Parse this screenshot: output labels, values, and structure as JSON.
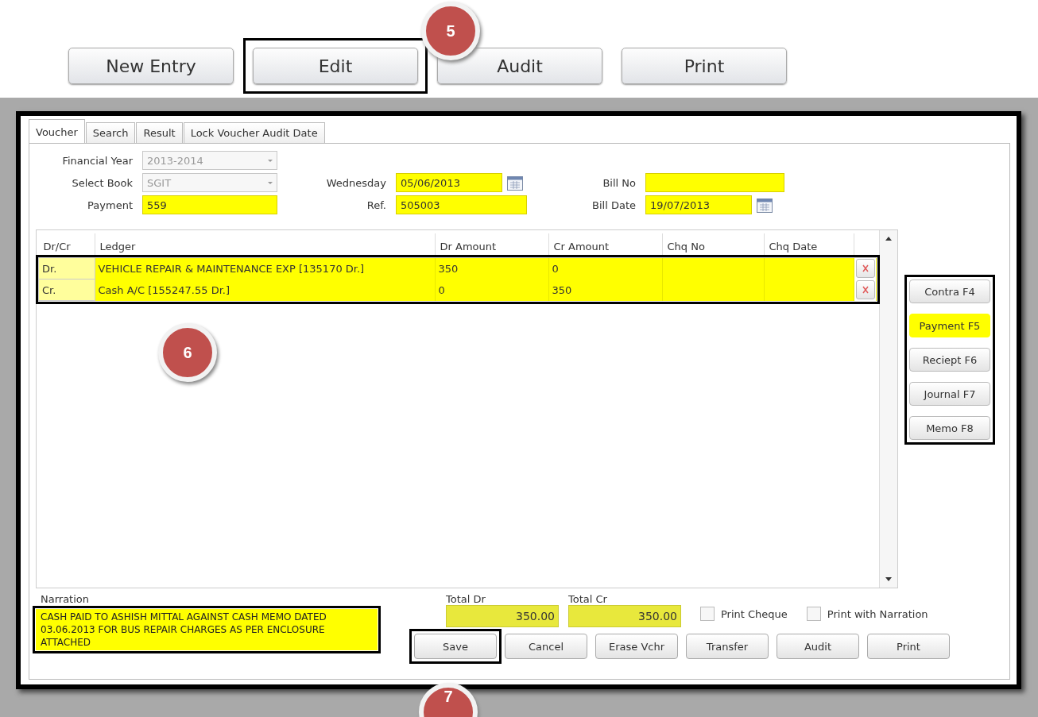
{
  "top_toolbar": {
    "buttons": [
      {
        "label": "New Entry"
      },
      {
        "label": "Edit"
      },
      {
        "label": "Audit"
      },
      {
        "label": "Print"
      }
    ]
  },
  "tabs": [
    {
      "label": "Voucher",
      "selected": true
    },
    {
      "label": "Search",
      "selected": false
    },
    {
      "label": "Result",
      "selected": false
    },
    {
      "label": "Lock Voucher Audit Date",
      "selected": false
    }
  ],
  "form_fields": [
    {
      "label": "Financial Year",
      "value": "2013-2014",
      "kind": "dropdown",
      "disabled": true
    },
    {
      "label": "Select Book",
      "value": "SGIT",
      "kind": "dropdown",
      "disabled": true
    },
    {
      "label": "Wednesday",
      "value": "05/06/2013",
      "kind": "date",
      "disabled": false
    },
    {
      "label": "Bill No",
      "kind": "text",
      "disabled": false
    },
    {
      "label": "Payment",
      "value": "559",
      "kind": "text",
      "disabled": false
    },
    {
      "label": "Ref.",
      "value": "505003",
      "kind": "text",
      "disabled": false
    },
    {
      "label": "Bill Date",
      "value": "19/07/2013",
      "kind": "date",
      "disabled": false
    }
  ],
  "entries_table": {
    "columns": [
      "Dr/Cr",
      "Ledger",
      "Dr Amount",
      "Cr Amount",
      "Chq No",
      "Chq Date"
    ],
    "rows": [
      {
        "dr_cr": "Dr.",
        "ledger": "VEHICLE REPAIR & MAINTENANCE EXP [135170 Dr.]",
        "dr_amount": "350",
        "cr_amount": "0"
      },
      {
        "dr_cr": "Cr.",
        "ledger": "Cash A/C [155247.55 Dr.]",
        "dr_amount": "0",
        "cr_amount": "350"
      }
    ]
  },
  "voucher_types": [
    {
      "label": "Contra F4",
      "selected": false
    },
    {
      "label": "Payment F5",
      "selected": true
    },
    {
      "label": "Reciept F6",
      "selected": false
    },
    {
      "label": "Journal F7",
      "selected": false
    },
    {
      "label": "Memo F8",
      "selected": false
    }
  ],
  "narration": {
    "label": "Narration",
    "value": "CASH PAID TO ASHISH MITTAL AGAINST CASH MEMO DATED 03.06.2013 FOR BUS REPAIR CHARGES AS PER ENCLOSURE ATTACHED"
  },
  "totals": [
    {
      "label": "Total Dr",
      "value": "350.00"
    },
    {
      "label": "Total Cr",
      "value": "350.00"
    }
  ],
  "options": [
    {
      "label": "Print Cheque",
      "checked": false
    },
    {
      "label": "Print with Narration",
      "checked": false
    }
  ],
  "actions": [
    {
      "label": "Save"
    },
    {
      "label": "Cancel"
    },
    {
      "label": "Erase Vchr"
    },
    {
      "label": "Transfer"
    },
    {
      "label": "Audit"
    },
    {
      "label": "Print"
    }
  ],
  "callouts": [
    {
      "number": "5"
    },
    {
      "number": "6"
    },
    {
      "number": "7"
    }
  ]
}
